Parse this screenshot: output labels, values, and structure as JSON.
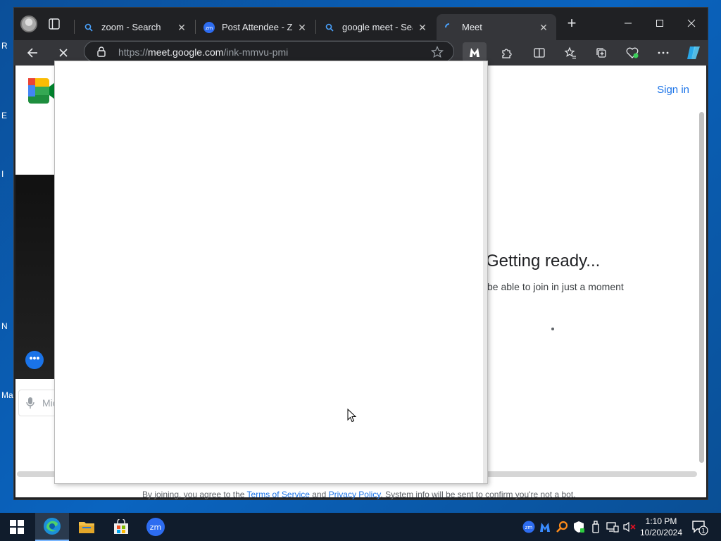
{
  "browser": {
    "tabs": [
      {
        "label": "zoom - Search",
        "icon": "search-icon",
        "active": false
      },
      {
        "label": "Post Attendee - Zoom",
        "icon": "zoom-icon",
        "active": false
      },
      {
        "label": "google meet - Search",
        "icon": "search-icon",
        "active": false
      },
      {
        "label": "Meet",
        "icon": "meet-loading-icon",
        "active": true
      }
    ],
    "url_prefix": "https://",
    "url_domain": "meet.google.com",
    "url_path": "/ink-mmvu-pmi"
  },
  "page": {
    "signin_label": "Sign in",
    "mic_label": "Mic",
    "ready_title": "Getting ready...",
    "ready_subtitle": "be able to join in just a moment",
    "disclaimer_pre": "By joining, you agree to the ",
    "terms_label": "Terms of Service",
    "disclaimer_and": " and ",
    "privacy_label": "Privacy Policy",
    "disclaimer_post": ". System info will be sent to confirm you're not a bot."
  },
  "desktop_fragments": [
    "R",
    "E",
    "I",
    "N",
    "Ma"
  ],
  "taskbar": {
    "apps": [
      "edge",
      "file-explorer",
      "microsoft-store",
      "zoom"
    ],
    "time": "1:10 PM",
    "date": "10/20/2024",
    "notification_count": "1"
  },
  "colors": {
    "accent": "#1a73e8",
    "tab_bg": "#202124",
    "toolbar_bg": "#35363a",
    "taskbar_bg": "#101c2c"
  }
}
